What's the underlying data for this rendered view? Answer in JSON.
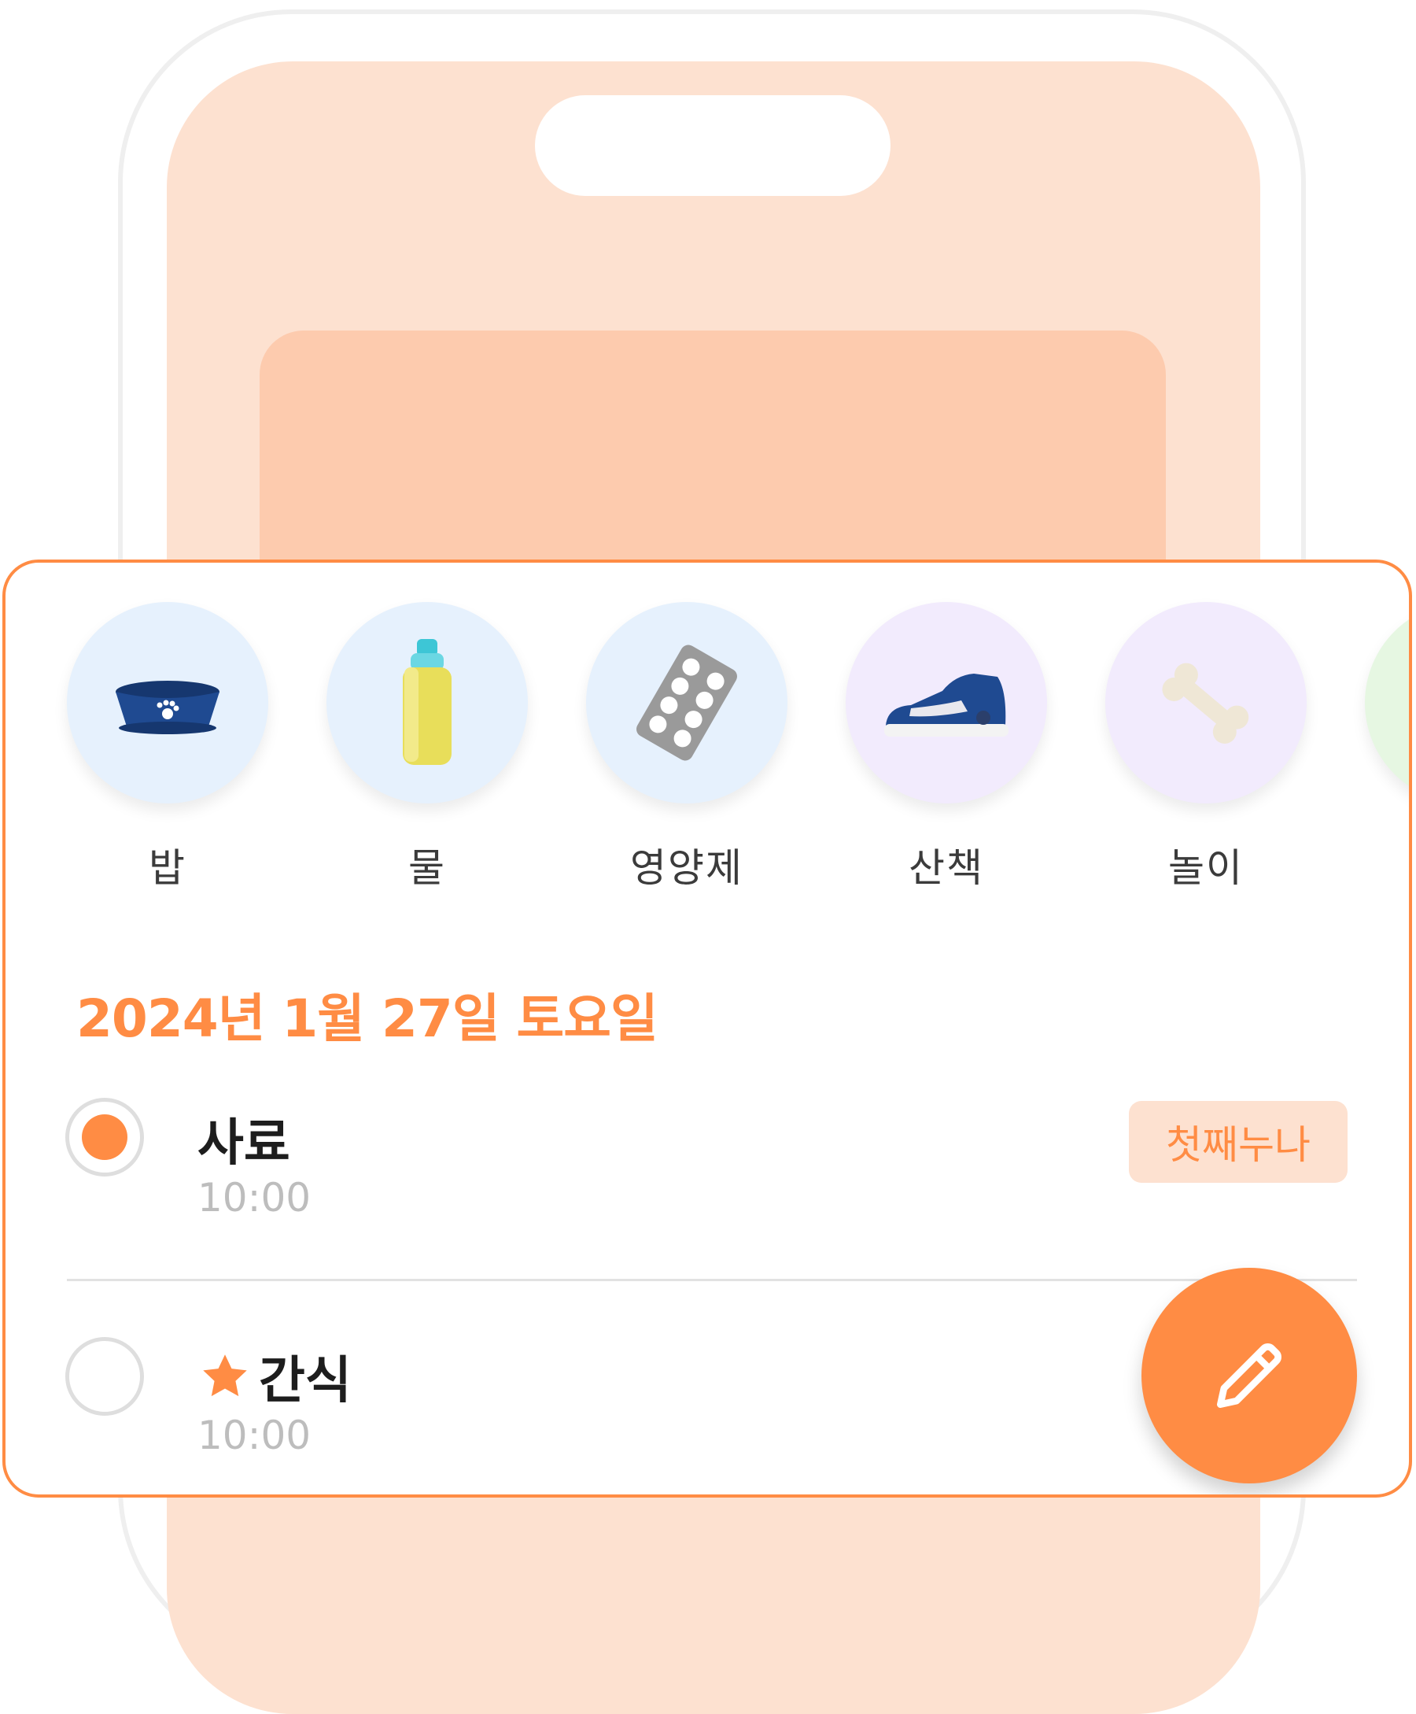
{
  "categories": [
    {
      "label": "밥",
      "icon": "bowl-icon",
      "bg": "#e6f1fd"
    },
    {
      "label": "물",
      "icon": "water-bottle-icon",
      "bg": "#e6f1fd"
    },
    {
      "label": "영양제",
      "icon": "pill-pack-icon",
      "bg": "#e6f1fd"
    },
    {
      "label": "산책",
      "icon": "sneaker-icon",
      "bg": "#f2ebfd"
    },
    {
      "label": "놀이",
      "icon": "bone-icon",
      "bg": "#f2ebfd"
    },
    {
      "label": "",
      "icon": "",
      "bg": "#e6f7e2"
    }
  ],
  "date_heading": "2024년 1월 27일 토요일",
  "tasks": [
    {
      "title": "사료",
      "time": "10:00",
      "done": true,
      "starred": false,
      "assignee": "첫째누나"
    },
    {
      "title": "간식",
      "time": "10:00",
      "done": false,
      "starred": true,
      "assignee": ""
    }
  ],
  "colors": {
    "accent": "#ff8c44",
    "accent_light": "#fde1d0",
    "phone_bg": "#fde1d0",
    "phone_card": "#fdcbae"
  },
  "fab": {
    "icon": "pencil-icon"
  }
}
